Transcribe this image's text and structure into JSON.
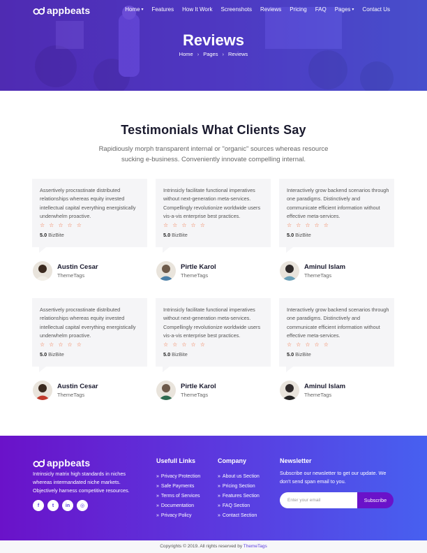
{
  "brand": {
    "name": "appbeats"
  },
  "nav": {
    "items": [
      {
        "label": "Home",
        "dropdown": true
      },
      {
        "label": "Features",
        "dropdown": false
      },
      {
        "label": "How It Work",
        "dropdown": false
      },
      {
        "label": "Screenshots",
        "dropdown": false
      },
      {
        "label": "Reviews",
        "dropdown": false
      },
      {
        "label": "Pricing",
        "dropdown": false
      },
      {
        "label": "FAQ",
        "dropdown": false
      },
      {
        "label": "Pages",
        "dropdown": true
      },
      {
        "label": "Contact Us",
        "dropdown": false
      }
    ]
  },
  "hero": {
    "title": "Reviews",
    "breadcrumb": [
      "Home",
      "Pages",
      "Reviews"
    ]
  },
  "intro": {
    "title": "Testimonials What Clients Say",
    "subtitle": "Rapidiously morph transparent internal or \"organic\" sources whereas resource sucking e-business. Conveniently innovate compelling internal."
  },
  "testimonials": [
    {
      "text": "Assertively procrastinate distributed relationships whereas equity invested intellectual capital everything energistically underwhelm proactive.",
      "stars": 5,
      "score": "5.0",
      "source": "BizBite",
      "name": "Austin Cesar",
      "company": "ThemeTags"
    },
    {
      "text": "Intrinsicly facilitate functional imperatives without next-generation meta-services. Compellingly revolutionize worldwide users vis-a-vis enterprise best practices.",
      "stars": 5,
      "score": "5.0",
      "source": "BizBite",
      "name": "Pirtle Karol",
      "company": "ThemeTags"
    },
    {
      "text": "Interactively grow backend scenarios through one paradigms. Distinctively and communicate efficient information without effective meta-services.",
      "stars": 5,
      "score": "5.0",
      "source": "BizBite",
      "name": "Aminul Islam",
      "company": "ThemeTags"
    },
    {
      "text": "Assertively procrastinate distributed relationships whereas equity invested intellectual capital everything energistically underwhelm proactive.",
      "stars": 5,
      "score": "5.0",
      "source": "BizBite",
      "name": "Austin Cesar",
      "company": "ThemeTags"
    },
    {
      "text": "Intrinsicly facilitate functional imperatives without next-generation meta-services. Compellingly revolutionize worldwide users vis-a-vis enterprise best practices.",
      "stars": 5,
      "score": "5.0",
      "source": "BizBite",
      "name": "Pirtle Karol",
      "company": "ThemeTags"
    },
    {
      "text": "Interactively grow backend scenarios through one paradigms. Distinctively and communicate efficient information without effective meta-services.",
      "stars": 5,
      "score": "5.0",
      "source": "BizBite",
      "name": "Aminul Islam",
      "company": "ThemeTags"
    }
  ],
  "footer": {
    "about": "Intrinsicly matrix high standards in niches whereas intermandated niche markets. Objectively harness competitive resources.",
    "socials": [
      {
        "icon": "facebook-icon",
        "glyph": "f"
      },
      {
        "icon": "twitter-icon",
        "glyph": "t"
      },
      {
        "icon": "linkedin-icon",
        "glyph": "in"
      },
      {
        "icon": "dribbble-icon",
        "glyph": "◎"
      }
    ],
    "useful_links": {
      "title": "Usefull Links",
      "items": [
        "Privacy Protection",
        "Safe Payments",
        "Terms of Services",
        "Documentation",
        "Privacy Policy"
      ]
    },
    "company": {
      "title": "Company",
      "items": [
        "About us Section",
        "Pricing Section",
        "Features Section",
        "FAQ Section",
        "Contact Section"
      ]
    },
    "newsletter": {
      "title": "Newsletter",
      "text": "Subscribe our newsletter to get our update. We don't send span email to you.",
      "placeholder": "Enter your email",
      "button": "Subscribe"
    }
  },
  "copyright": {
    "text": "Copyrights © 2019. All rights reserved by",
    "link": "ThemeTags"
  },
  "colors": {
    "accent": "#5a3ce0",
    "star": "#f26b3a",
    "footer_start": "#6a12c9",
    "footer_end": "#4760f0"
  }
}
